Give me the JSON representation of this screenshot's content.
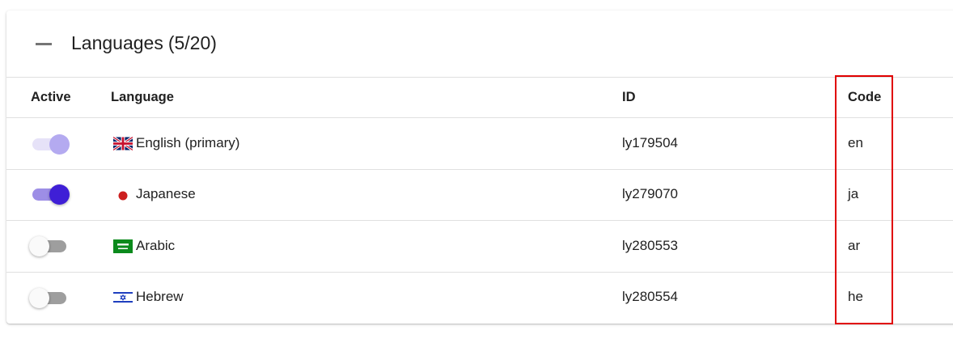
{
  "panel": {
    "title": "Languages",
    "count": "(5/20)"
  },
  "columns": {
    "active": "Active",
    "language": "Language",
    "id": "ID",
    "code": "Code"
  },
  "rows": [
    {
      "active": true,
      "active_style": "disabled-on",
      "flag": "uk-flag-icon",
      "language": "English (primary)",
      "id": "ly179504",
      "code": "en"
    },
    {
      "active": true,
      "active_style": "on",
      "flag": "japan-flag-icon",
      "language": "Japanese",
      "id": "ly279070",
      "code": "ja"
    },
    {
      "active": false,
      "active_style": "off",
      "flag": "saudi-flag-icon",
      "language": "Arabic",
      "id": "ly280553",
      "code": "ar"
    },
    {
      "active": false,
      "active_style": "off",
      "flag": "israel-flag-icon",
      "language": "Hebrew",
      "id": "ly280554",
      "code": "he"
    }
  ],
  "colors": {
    "toggle_on_thumb": "#3f1fd6",
    "toggle_on_track": "#9d8ee6",
    "toggle_disabled_thumb": "#b4aaf0",
    "toggle_disabled_track": "#e6e2f8",
    "highlight": "#e00000"
  }
}
